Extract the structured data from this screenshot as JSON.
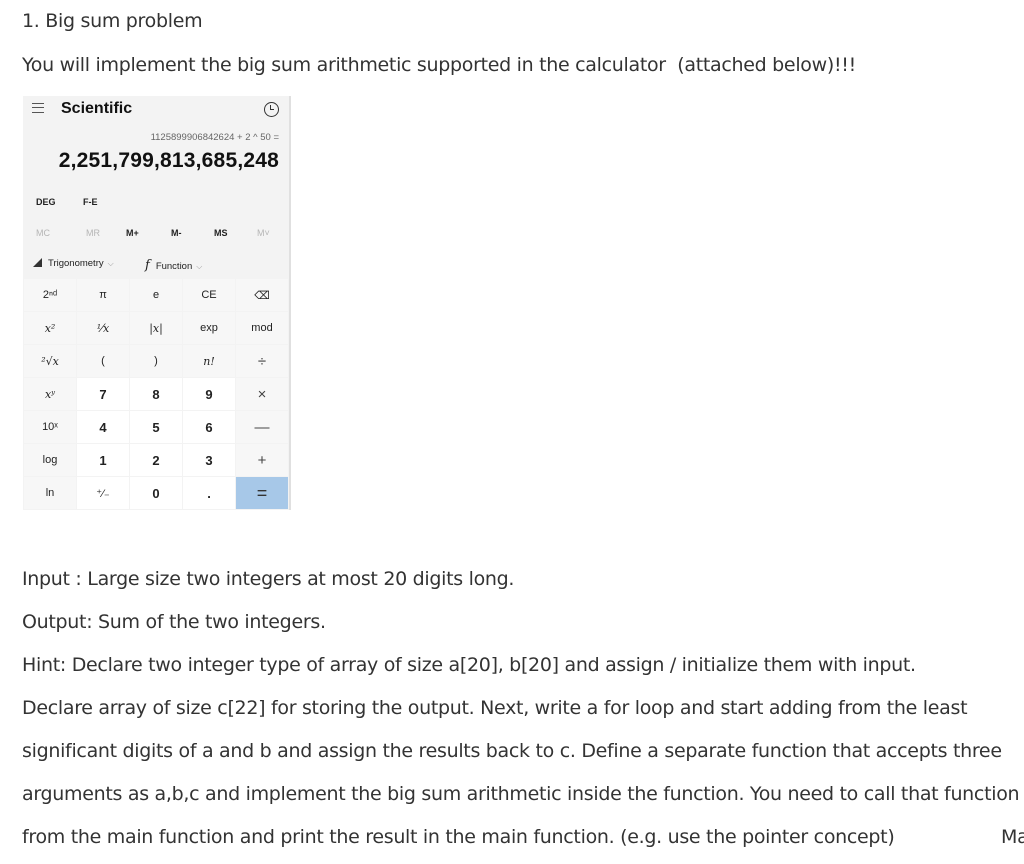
{
  "heading": "1. Big sum problem",
  "intro": "You will implement the big sum arithmetic supported in the calculator  (attached below)!!!",
  "calculator": {
    "mode": "Scientific",
    "menu_icon": "hamburger-icon",
    "history_icon": "history-icon",
    "expression": "1125899906842624 + 2 ^ 50 =",
    "result": "2,251,799,813,685,248",
    "angle_mode": "DEG",
    "fe_label": "F-E",
    "memory": [
      "MC",
      "MR",
      "M+",
      "M-",
      "MS",
      "M˅"
    ],
    "memory_disabled": [
      true,
      true,
      false,
      false,
      false,
      true
    ],
    "dropdowns": [
      {
        "icon": "triangle-ruler-icon",
        "label": "Trigonometry"
      },
      {
        "icon": "function-icon",
        "label": "Function"
      }
    ],
    "keys": [
      "2ⁿᵈ",
      "π",
      "e",
      "CE",
      "⌫",
      "x²",
      "¹⁄x",
      "|x|",
      "exp",
      "mod",
      "²√x",
      "(",
      ")",
      "n!",
      "÷",
      "xʸ",
      "7",
      "8",
      "9",
      "×",
      "10ˣ",
      "4",
      "5",
      "6",
      "—",
      "log",
      "1",
      "2",
      "3",
      "+",
      "ln",
      "⁺⁄₋",
      "0",
      ".",
      "="
    ],
    "accent_color": "#a7c8e8"
  },
  "paragraphs": [
    "Input : Large size two integers at most 20 digits long.",
    "Output: Sum of the two integers.",
    "Hint: Declare two integer type of array of size a[20], b[20] and assign / initialize them with input.",
    "Declare array of size c[22] for storing the output. Next, write a for loop and start adding from the least",
    "significant digits of a and b and assign the results back to c. Define a separate function that accepts three",
    "arguments as a,b,c and implement the big sum arithmetic inside the function. You need to call that function",
    "from the main function and print the result in the main function. (e.g. use the pointer concept)"
  ],
  "truncated_tail": "Ma"
}
